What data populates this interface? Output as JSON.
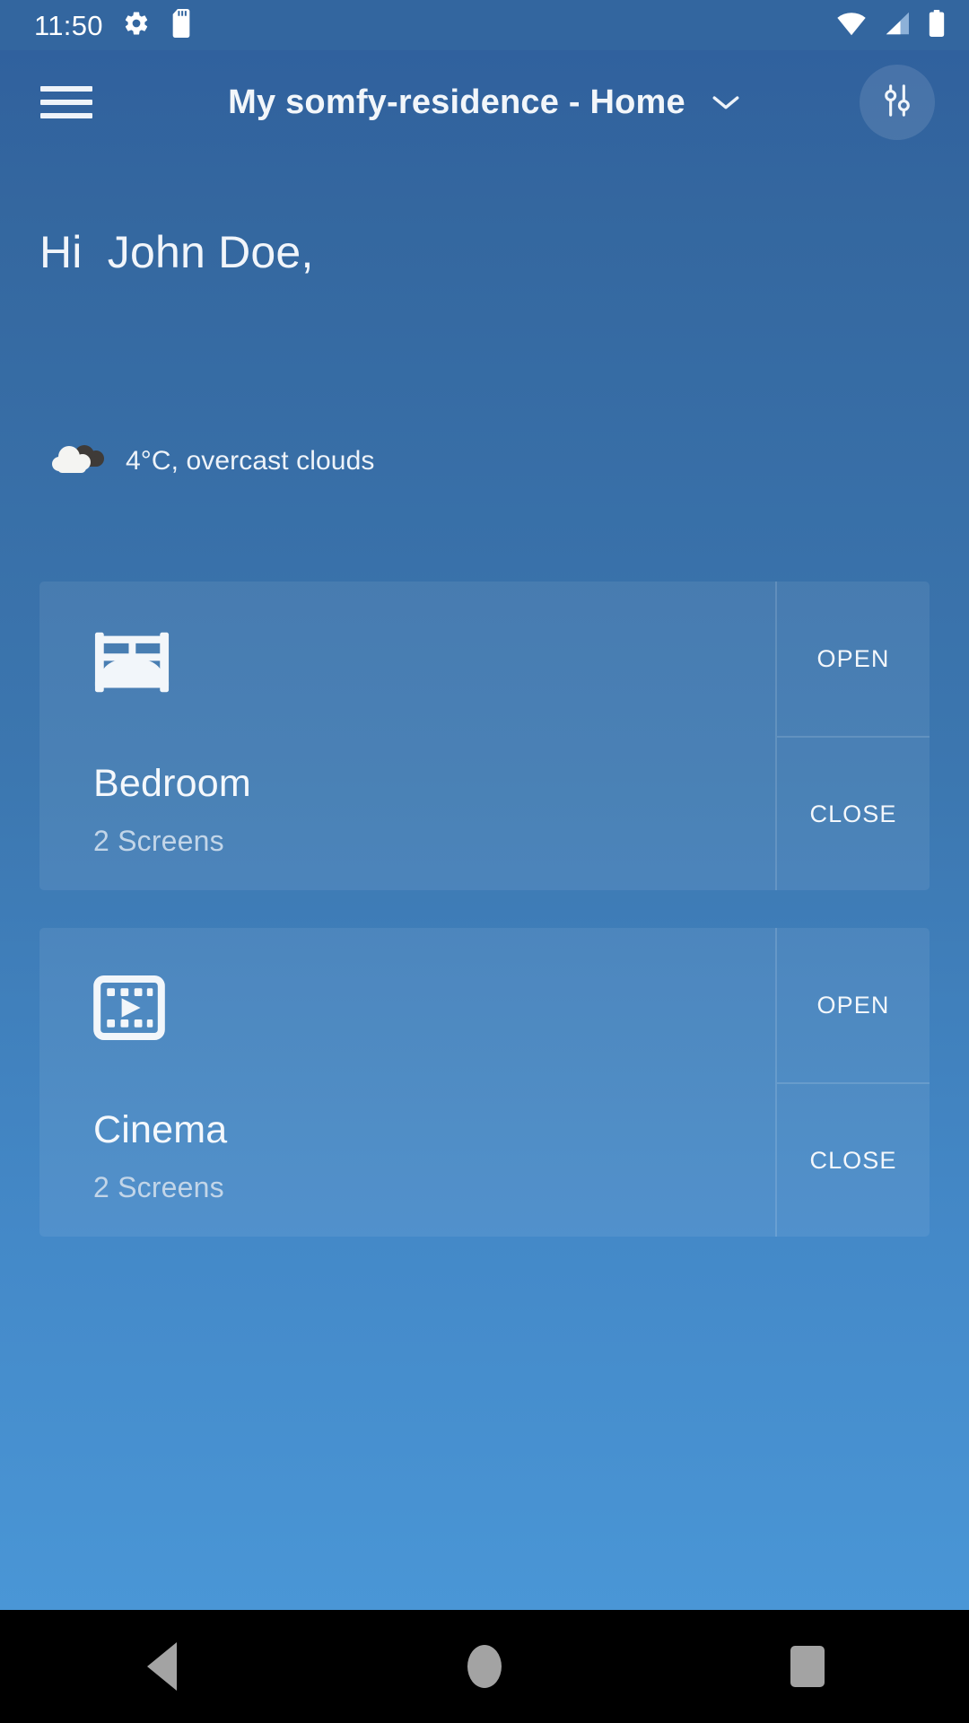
{
  "status_bar": {
    "clock": "11:50",
    "icons": [
      "gear-icon",
      "sd-card-icon",
      "wifi-icon",
      "cellular-signal-icon",
      "battery-icon"
    ]
  },
  "app_bar": {
    "menu_label": "menu",
    "title": "My somfy-residence - Home",
    "title_chevron": "chevron-down-icon",
    "tune_button": "tune-icon"
  },
  "greeting": {
    "text": "Hi  John Doe,"
  },
  "weather": {
    "icon": "overcast-clouds-icon",
    "text": "4°C, overcast clouds",
    "temperature": "4°C",
    "condition": "overcast clouds"
  },
  "rooms": [
    {
      "icon": "bed-icon",
      "name": "Bedroom",
      "subtitle": "2 Screens",
      "open_label": "OPEN",
      "close_label": "CLOSE"
    },
    {
      "icon": "film-play-icon",
      "name": "Cinema",
      "subtitle": "2 Screens",
      "open_label": "OPEN",
      "close_label": "CLOSE"
    }
  ],
  "nav_bar": {
    "back": "back-icon",
    "home": "home-icon",
    "recents": "recents-icon"
  },
  "colors": {
    "gradient_top": "#2f5f9e",
    "gradient_bottom": "#4c9ada",
    "status_bar": "#33669f",
    "card_surface": "rgba(255,255,255,0.075)",
    "text_primary": "#f2f6fa",
    "text_secondary": "#c2d5e8",
    "nav_bar": "#000000",
    "nav_icon": "#a3a3a3"
  }
}
